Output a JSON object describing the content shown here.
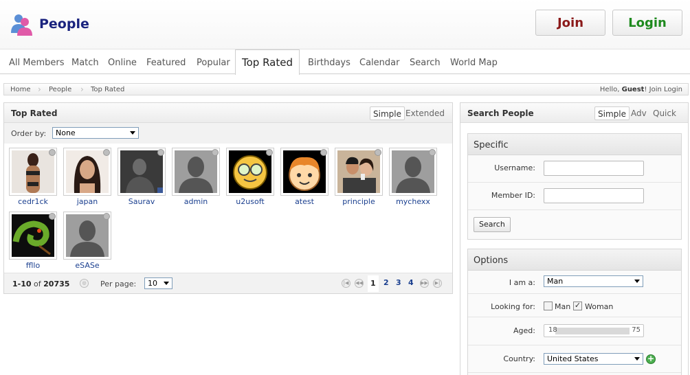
{
  "header": {
    "title": "People",
    "join_label": "Join",
    "login_label": "Login",
    "colors": {
      "title": "#1a237e",
      "join": "#8b1a1a",
      "login": "#1e8a1e"
    }
  },
  "nav": {
    "tabs": [
      "All Members",
      "Match",
      "Online",
      "Featured",
      "Popular",
      "Top Rated",
      "Birthdays",
      "Calendar",
      "Search",
      "World Map"
    ],
    "active": "Top Rated"
  },
  "breadcrumb": {
    "items": [
      "Home",
      "People",
      "Top Rated"
    ],
    "greeting_prefix": "Hello, ",
    "greeting_user": "Guest",
    "greeting_suffix": "! ",
    "join_link": "Join",
    "login_link": "Login"
  },
  "main": {
    "title": "Top Rated",
    "view_tabs": [
      "Simple",
      "Extended"
    ],
    "active_view": "Simple",
    "order_label": "Order by:",
    "order_value": "None",
    "members": [
      {
        "name": "cedr1ck",
        "avatar": "photo-woman-bikini-icon"
      },
      {
        "name": "japan",
        "avatar": "photo-woman-icon"
      },
      {
        "name": "Saurav",
        "avatar": "photo-dark-icon"
      },
      {
        "name": "admin",
        "avatar": "default-avatar-icon"
      },
      {
        "name": "u2usoft",
        "avatar": "cartoon-glasses-face-icon"
      },
      {
        "name": "atest",
        "avatar": "cartoon-boy-face-icon"
      },
      {
        "name": "principle",
        "avatar": "photo-couple-icon"
      },
      {
        "name": "mychexx",
        "avatar": "default-avatar-icon"
      },
      {
        "name": "ffllo",
        "avatar": "photo-chameleon-icon"
      },
      {
        "name": "eSASe",
        "avatar": "default-avatar-icon"
      }
    ],
    "pager": {
      "range": "1-10",
      "of": "of",
      "total": "20735",
      "per_page_label": "Per page:",
      "per_page_value": "10",
      "pages": [
        "1",
        "2",
        "3",
        "4"
      ],
      "current": "1"
    }
  },
  "search": {
    "title": "Search People",
    "tabs": [
      "Simple",
      "Adv",
      "Quick"
    ],
    "active_tab": "Simple",
    "specific": {
      "heading": "Specific",
      "username_label": "Username:",
      "member_id_label": "Member ID:",
      "button": "Search"
    },
    "options": {
      "heading": "Options",
      "i_am_label": "I am a:",
      "i_am_value": "Man",
      "looking_label": "Looking for:",
      "looking_man": "Man",
      "looking_woman": "Woman",
      "looking_man_checked": false,
      "looking_woman_checked": true,
      "aged_label": "Aged:",
      "age_min": "18",
      "age_max": "75",
      "country_label": "Country:",
      "country_value": "United States"
    }
  }
}
